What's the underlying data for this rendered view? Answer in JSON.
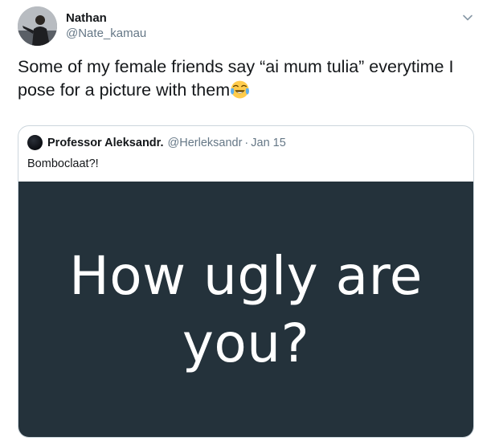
{
  "tweet": {
    "author": {
      "display_name": "Nathan",
      "handle": "@Nate_kamau",
      "avatar_icon": "profile-photo"
    },
    "menu_icon": "chevron-down-icon",
    "text": "Some of my female friends say “ai mum tulia” everytime I pose for a picture with them",
    "emoji": "face-with-tears-of-joy",
    "quoted": {
      "display_name": "Professor Aleksandr.",
      "handle": "@Herleksandr",
      "separator": "·",
      "date": "Jan 15",
      "text": "Bomboclaat?!",
      "media": {
        "line1": "How ugly are",
        "line2": "you?",
        "background": "#24323b"
      }
    }
  },
  "colors": {
    "text_primary": "#14171a",
    "text_secondary": "#657786",
    "border": "#ccd6dd"
  }
}
